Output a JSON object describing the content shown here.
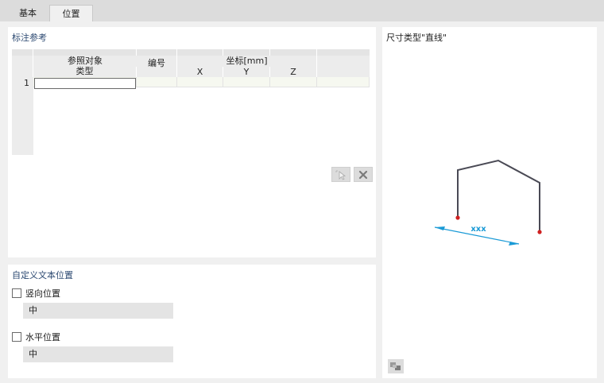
{
  "tabs": [
    {
      "label": "基本"
    },
    {
      "label": "位置"
    }
  ],
  "reference": {
    "title": "标注参考",
    "table": {
      "group_headers": {
        "ref_object": "参照对象",
        "coords": "坐标[mm]"
      },
      "columns": {
        "type": "类型",
        "number": "编号",
        "x": "X",
        "y": "Y",
        "z": "Z"
      },
      "rows": [
        {
          "index": "1",
          "type": "",
          "number": "",
          "x": "",
          "y": "",
          "z": ""
        }
      ]
    }
  },
  "custom_text": {
    "title": "自定义文本位置",
    "vertical": {
      "label": "竖向位置",
      "checked": false,
      "value": "中"
    },
    "horizontal": {
      "label": "水平位置",
      "checked": false,
      "value": "中"
    }
  },
  "preview": {
    "title": "尺寸类型\"直线\"",
    "dimension_label": "xxx",
    "colors": {
      "frame": "#4a4a55",
      "dimension": "#1a9ad6",
      "point": "#d02020"
    }
  }
}
